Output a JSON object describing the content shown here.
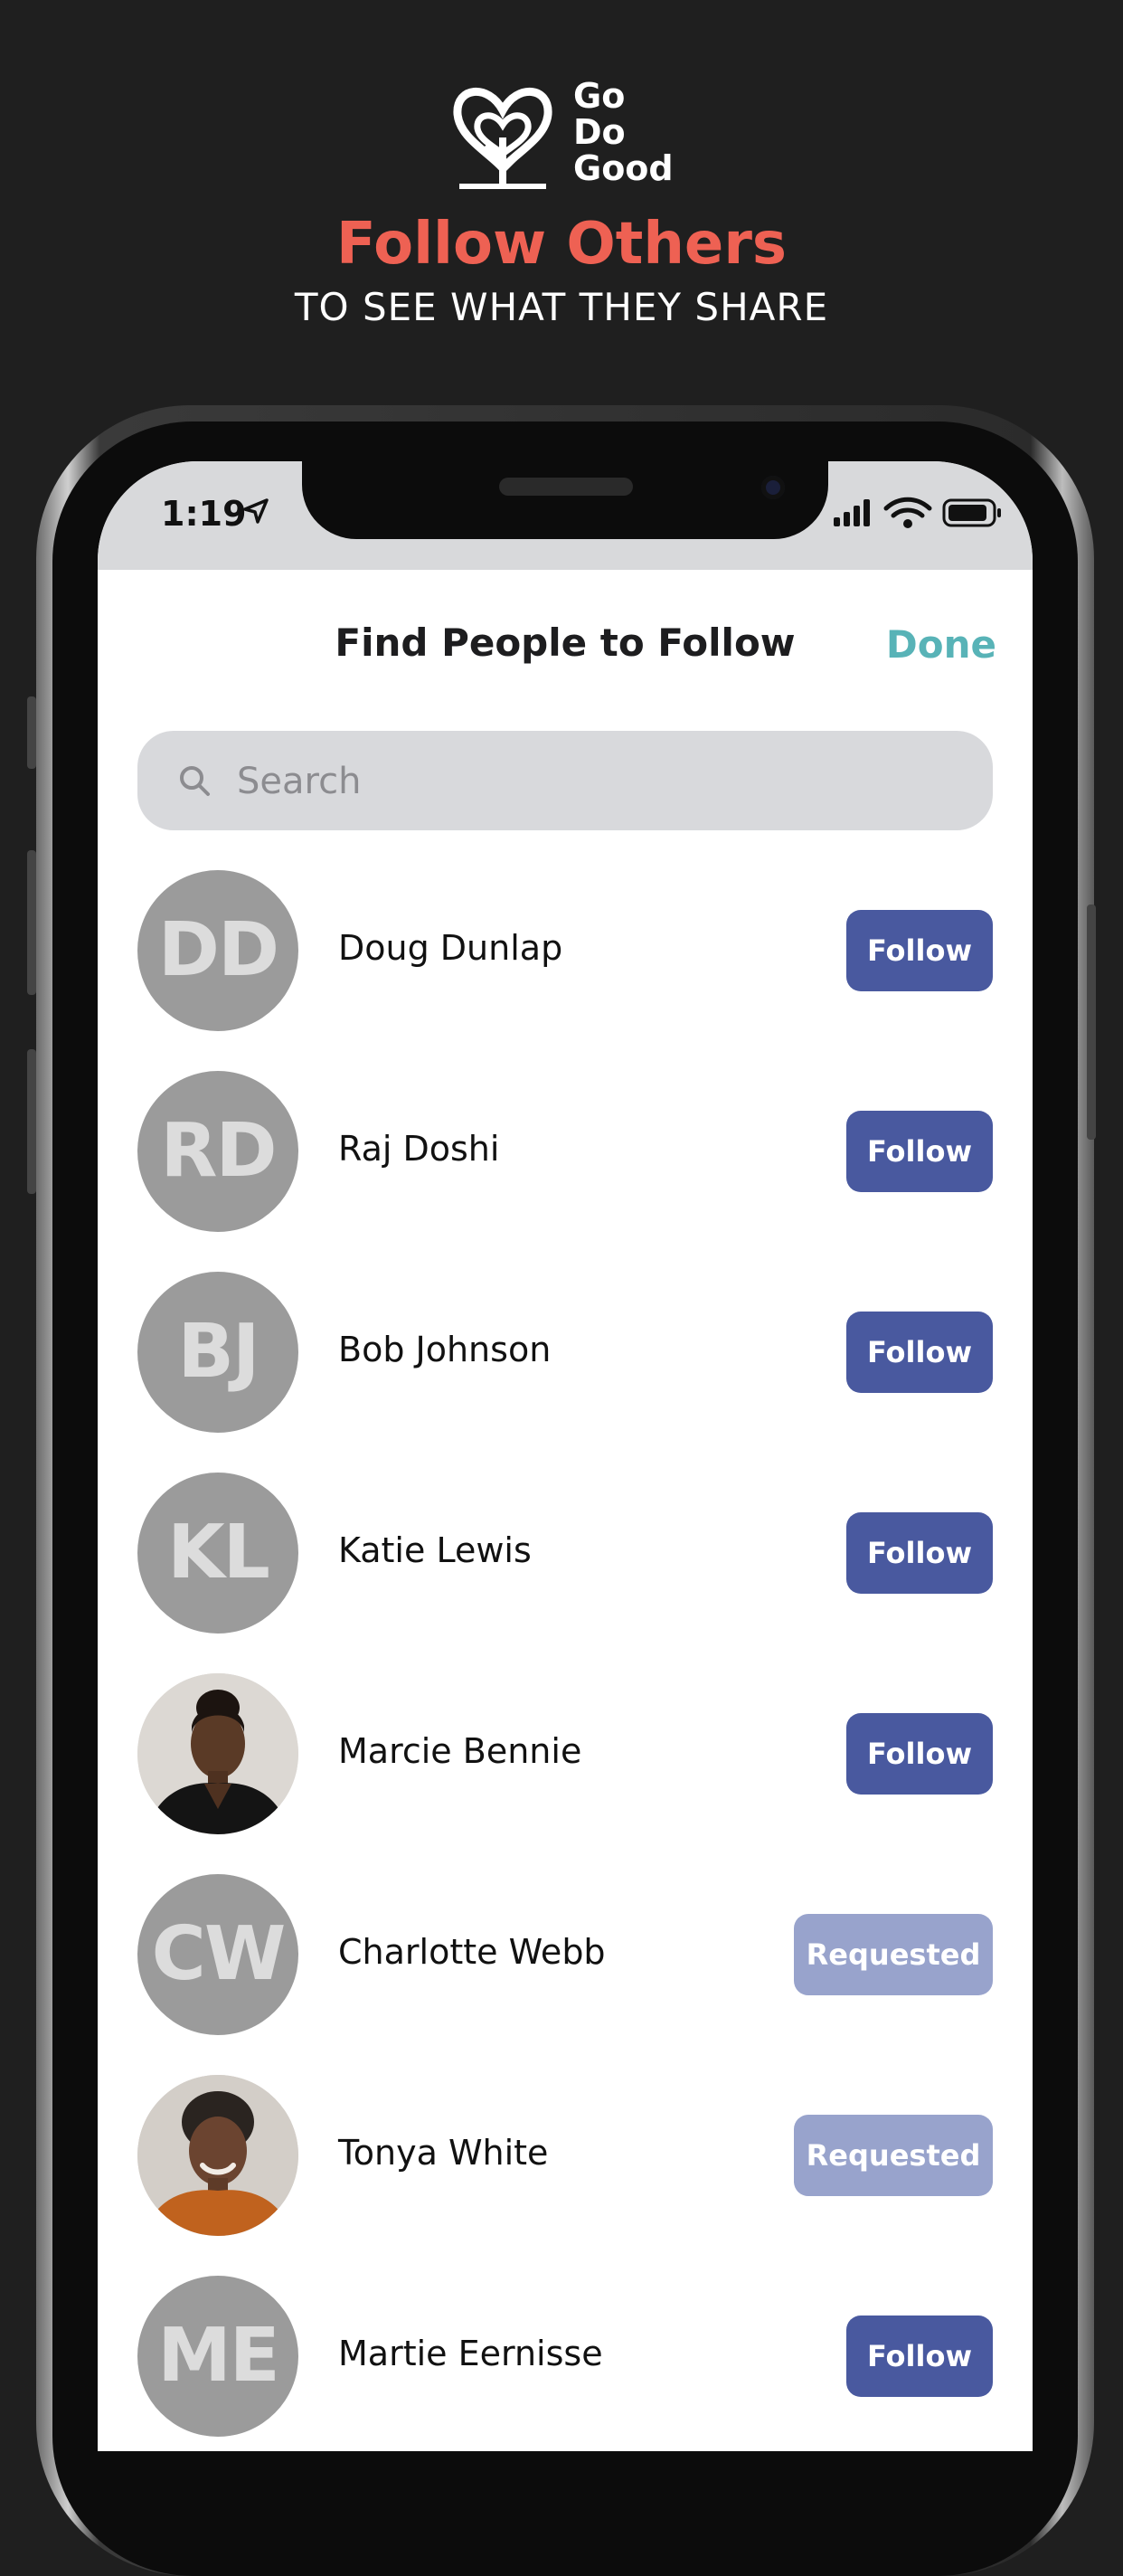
{
  "promo": {
    "logo_lines": [
      "Go",
      "Do",
      "Good"
    ],
    "headline": "Follow Others",
    "subhead": "TO SEE WHAT THEY SHARE"
  },
  "status_bar": {
    "time": "1:19"
  },
  "header": {
    "title": "Find People to Follow",
    "done_label": "Done"
  },
  "search": {
    "placeholder": "Search",
    "value": ""
  },
  "people": [
    {
      "initials": "DD",
      "name": "Doug Dunlap",
      "action": "Follow"
    },
    {
      "initials": "RD",
      "name": "Raj Doshi",
      "action": "Follow"
    },
    {
      "initials": "BJ",
      "name": "Bob Johnson",
      "action": "Follow"
    },
    {
      "initials": "KL",
      "name": "Katie Lewis",
      "action": "Follow"
    },
    {
      "initials": "",
      "name": "Marcie Bennie",
      "action": "Follow"
    },
    {
      "initials": "CW",
      "name": "Charlotte Webb",
      "action": "Requested"
    },
    {
      "initials": "",
      "name": "Tonya White",
      "action": "Requested"
    },
    {
      "initials": "ME",
      "name": "Martie Eernisse",
      "action": "Follow"
    }
  ],
  "colors": {
    "background": "#1f1f1f",
    "headline": "#ee6153",
    "done": "#58b3b7",
    "follow_button": "#49599f",
    "requested_button": "#98a3cc",
    "avatar": "#9b9b9b"
  }
}
